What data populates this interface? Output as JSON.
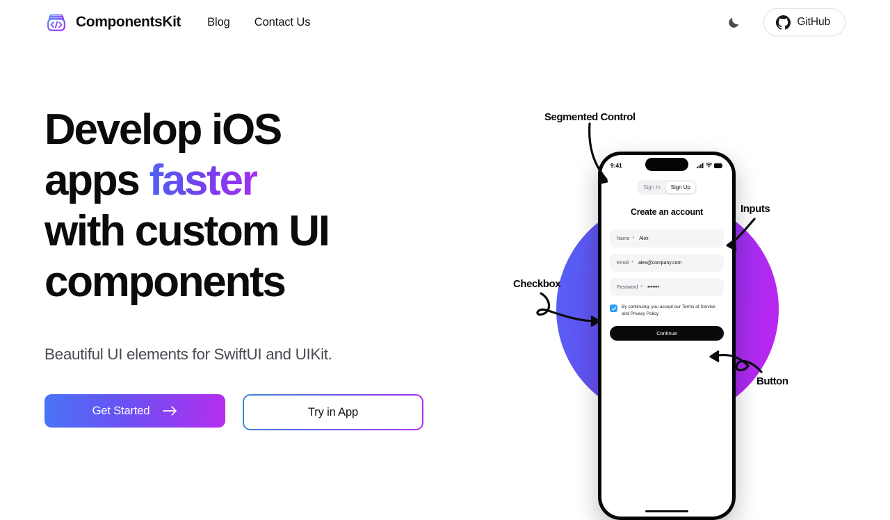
{
  "header": {
    "brand_name": "ComponentsKit",
    "logo_icon": "code-package-icon",
    "nav": [
      {
        "label": "Blog"
      },
      {
        "label": "Contact Us"
      }
    ],
    "theme_toggle_icon": "moon-icon",
    "github": {
      "label": "GitHub",
      "icon": "github-icon"
    }
  },
  "hero": {
    "headline_line1": "Develop iOS",
    "headline_line2_pre": "apps ",
    "headline_line2_accent": "faster",
    "headline_line3": "with custom UI",
    "headline_line4": "components",
    "subtitle": "Beautiful UI elements for SwiftUI and UIKit.",
    "primary_cta": {
      "label": "Get Started",
      "icon": "arrow-right-icon"
    },
    "secondary_cta": {
      "label": "Try in App"
    },
    "colors": {
      "gradient_start": "#4a74f6",
      "gradient_mid": "#6b50f3",
      "gradient_end": "#b52df0",
      "headline": "#0b0b0e",
      "subtitle": "#4a4a52"
    }
  },
  "showcase": {
    "annotations": [
      {
        "label": "Segmented Control"
      },
      {
        "label": "Inputs"
      },
      {
        "label": "Checkbox"
      },
      {
        "label": "Button"
      }
    ],
    "blob_gradient": {
      "from": "#5163f5",
      "to": "#c323ef"
    },
    "phone": {
      "status_bar": {
        "time": "9:41",
        "icons": [
          "cellular-signal-icon",
          "wifi-icon",
          "battery-icon"
        ]
      },
      "segmented_control": {
        "options": [
          {
            "label": "Sign In",
            "active": false
          },
          {
            "label": "Sign Up",
            "active": true
          }
        ]
      },
      "form_title": "Create an account",
      "fields": [
        {
          "label": "Name",
          "required_mark": "*",
          "value": "Alex"
        },
        {
          "label": "Email",
          "required_mark": "*",
          "value": "alex@company.com"
        },
        {
          "label": "Password",
          "required_mark": "*",
          "value": "•••••••"
        }
      ],
      "consent": {
        "checked": true,
        "text": "By continuing, you accept our Terms of Service and Privacy Policy"
      },
      "submit_label": "Continue"
    }
  }
}
